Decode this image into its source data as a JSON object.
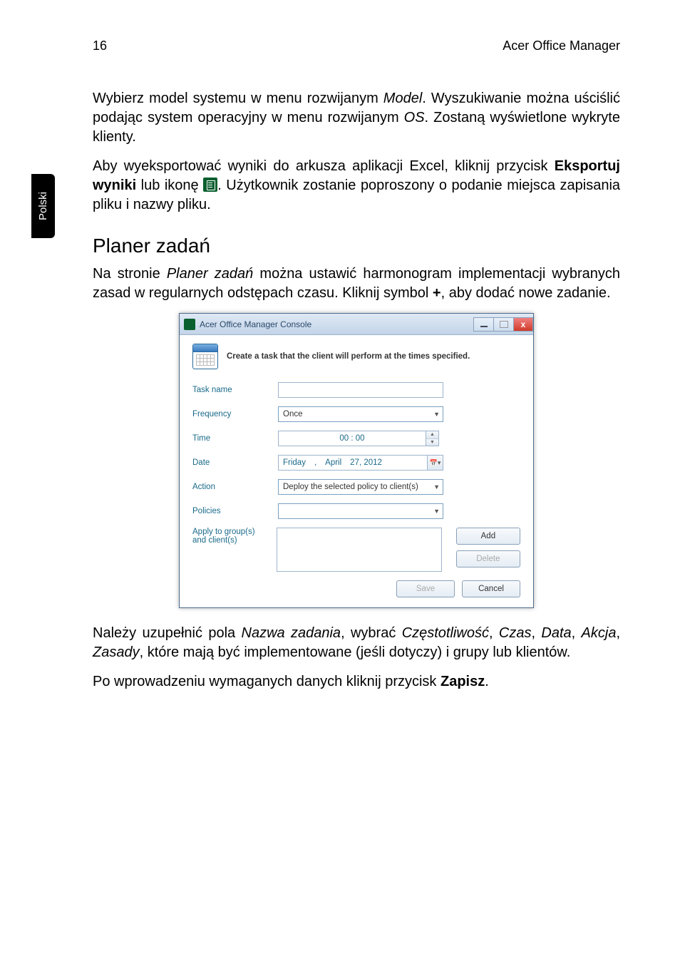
{
  "page": {
    "number": "16",
    "running_head": "Acer Office Manager",
    "sidebar_lang": "Polski"
  },
  "para1_pre": "Wybierz model systemu w menu rozwijanym ",
  "para1_em1": "Model",
  "para1_mid": ". Wyszukiwanie można uściślić podając system operacyjny w menu rozwijanym ",
  "para1_em2": "OS",
  "para1_end": ". Zostaną wyświetlone wykryte klienty.",
  "para2_pre": "Aby wyeksportować wyniki do arkusza aplikacji Excel, kliknij przycisk ",
  "para2_bold": "Eksportuj wyniki",
  "para2_mid": " lub ikonę ",
  "para2_end": ". Użytkownik zostanie poproszony o podanie miejsca zapisania pliku i nazwy pliku.",
  "heading": "Planer zadań",
  "para3_pre": "Na stronie ",
  "para3_em": "Planer zadań",
  "para3_mid": " można ustawić harmonogram implementacji wybranych zasad w regularnych odstępach czasu. Kliknij symbol ",
  "para3_bold": "+",
  "para3_end": ", aby dodać nowe zadanie.",
  "dialog": {
    "title": "Acer Office Manager Console",
    "desc": "Create a task that the client will perform at the times specified.",
    "labels": {
      "task_name": "Task name",
      "frequency": "Frequency",
      "time": "Time",
      "date": "Date",
      "action": "Action",
      "policies": "Policies",
      "apply_line1": "Apply to group(s)",
      "apply_line2": "and client(s)"
    },
    "values": {
      "frequency": "Once",
      "time": "00 : 00",
      "date_weekday": "Friday",
      "date_sep": ",",
      "date_month": "April",
      "date_day": "27, 2012",
      "action": "Deploy the selected policy to client(s)"
    },
    "buttons": {
      "add": "Add",
      "delete": "Delete",
      "save": "Save",
      "cancel": "Cancel"
    }
  },
  "para4_pre": "Należy uzupełnić pola ",
  "para4_em1": "Nazwa zadania",
  "para4_m1": ", wybrać ",
  "para4_em2": "Częstotliwość",
  "para4_m2": ", ",
  "para4_em3": "Czas",
  "para4_m3": ", ",
  "para4_em4": "Data",
  "para4_m4": ", ",
  "para4_em5": "Akcja",
  "para4_m5": ", ",
  "para4_em6": "Zasady",
  "para4_end": ", które mają być implementowane (jeśli dotyczy) i grupy lub klientów.",
  "para5_pre": "Po wprowadzeniu wymaganych danych kliknij przycisk ",
  "para5_bold": "Zapisz",
  "para5_end": "."
}
